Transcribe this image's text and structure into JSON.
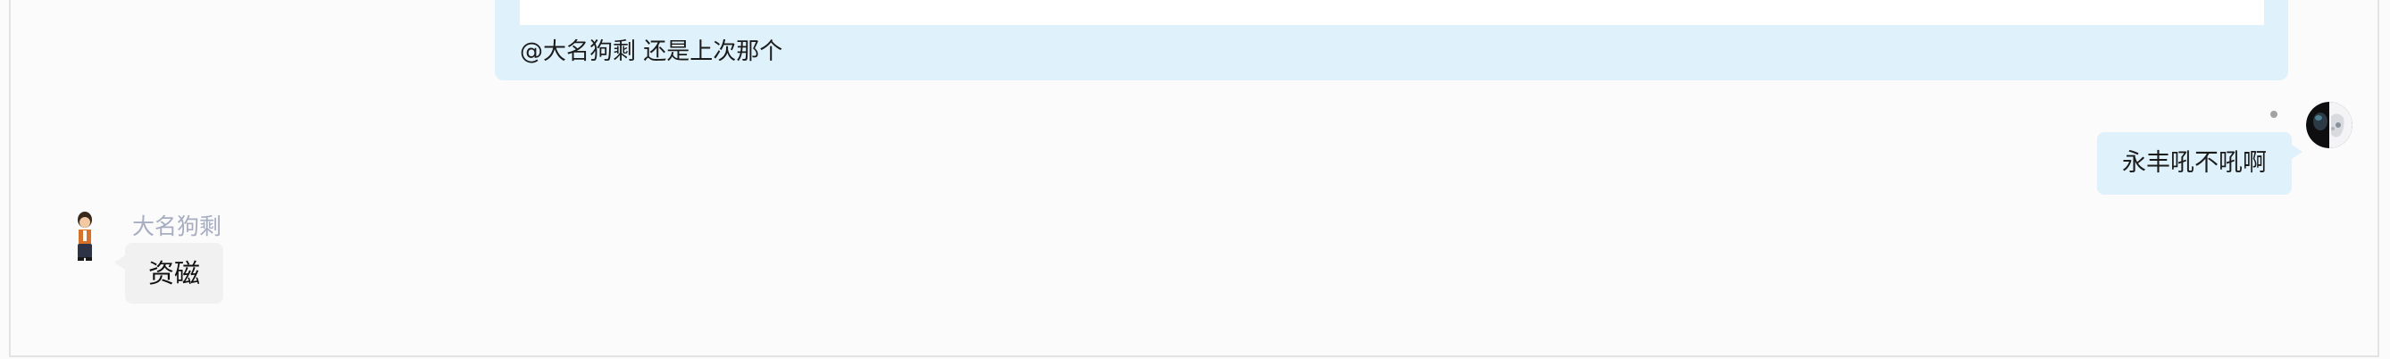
{
  "chat": {
    "quoted_message": {
      "text": "@大名狗剩 还是上次那个"
    },
    "outgoing_message": {
      "text": "永丰吼不吼啊"
    },
    "incoming_message": {
      "sender": "大名狗剩",
      "text": "资磁"
    }
  },
  "icons": {
    "my_avatar": "user-avatar-icon",
    "their_avatar": "character-avatar-icon",
    "status": "status-dot-icon"
  },
  "colors": {
    "outgoing_bubble": "#dff1fb",
    "incoming_bubble": "#f1f1f1",
    "sender_name": "#a7aec1",
    "background": "#fbfbfb"
  }
}
